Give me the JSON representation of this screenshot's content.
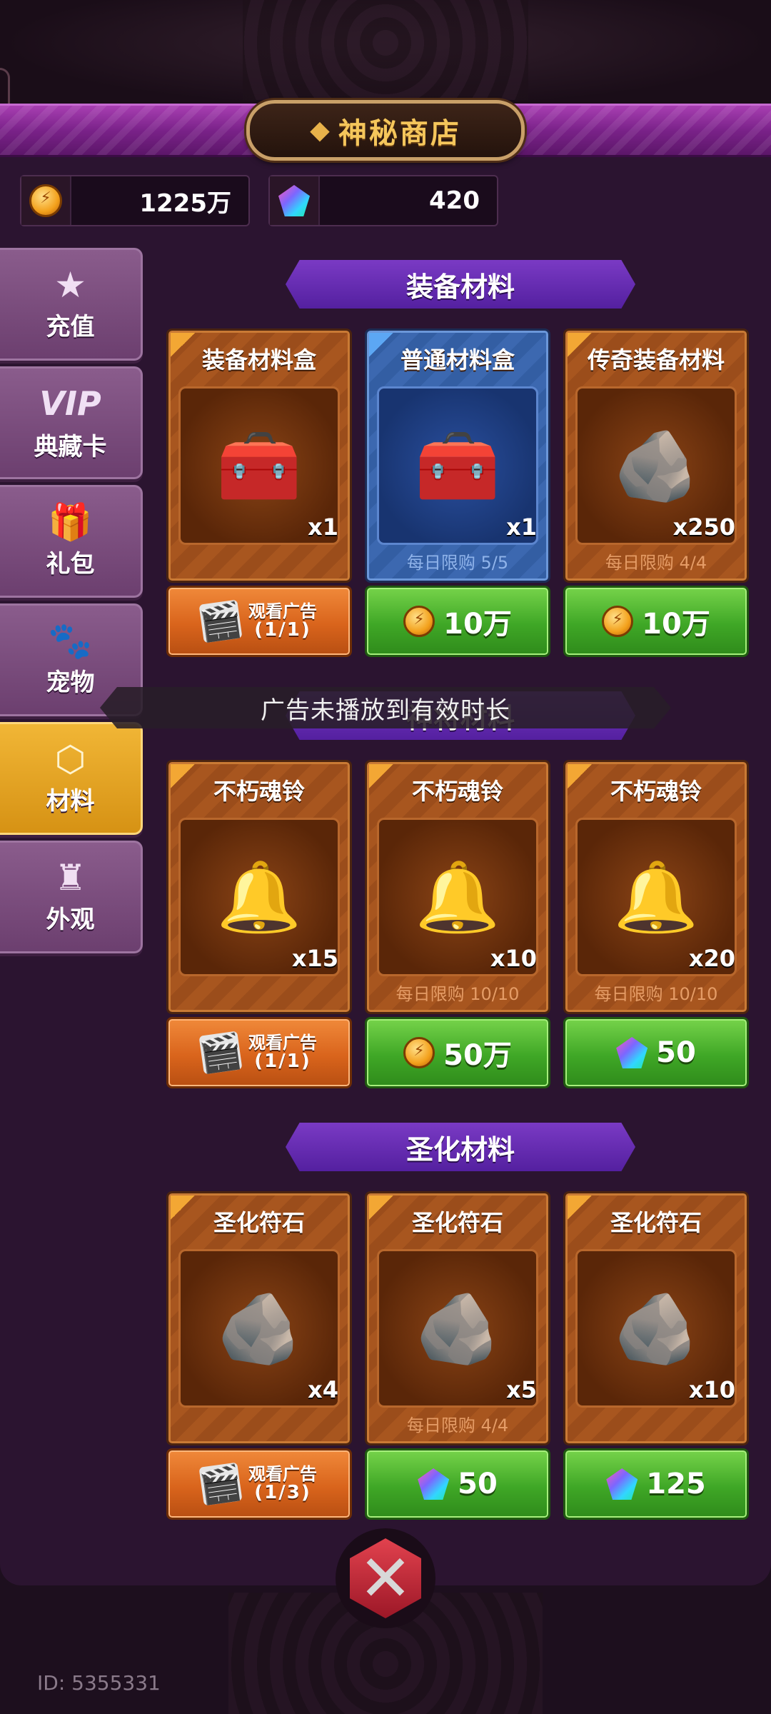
{
  "header": {
    "title": "神秘商店"
  },
  "currency": {
    "gold": "1225万",
    "diamonds": "420"
  },
  "sidebar": {
    "items": [
      {
        "label": "充值",
        "icon": "star-icon"
      },
      {
        "label": "典藏卡",
        "badge": "VIP",
        "icon": "vip-icon"
      },
      {
        "label": "礼包",
        "icon": "gift-icon"
      },
      {
        "label": "宠物",
        "icon": "pet-icon"
      },
      {
        "label": "材料",
        "icon": "hexagon-icon",
        "active": true
      },
      {
        "label": "外观",
        "icon": "armor-icon"
      }
    ]
  },
  "sections": [
    {
      "title": "装备材料",
      "items": [
        {
          "name": "装备材料盒",
          "qty": "x1",
          "limit": "",
          "price": "观看广告",
          "ad_count": "(1/1)",
          "currency": "ad",
          "style": "orange"
        },
        {
          "name": "普通材料盒",
          "qty": "x1",
          "limit": "每日限购 5/5",
          "price": "10万",
          "currency": "gold",
          "style": "blue"
        },
        {
          "name": "传奇装备材料",
          "qty": "x250",
          "limit": "每日限购 4/4",
          "price": "10万",
          "currency": "gold",
          "style": "orange"
        }
      ]
    },
    {
      "title": "神将材料",
      "items": [
        {
          "name": "不朽魂铃",
          "qty": "x15",
          "limit": "",
          "price": "观看广告",
          "ad_count": "(1/1)",
          "currency": "ad"
        },
        {
          "name": "不朽魂铃",
          "qty": "x10",
          "limit": "每日限购 10/10",
          "price": "50万",
          "currency": "gold"
        },
        {
          "name": "不朽魂铃",
          "qty": "x20",
          "limit": "每日限购 10/10",
          "price": "50",
          "currency": "diamond"
        }
      ]
    },
    {
      "title": "圣化材料",
      "items": [
        {
          "name": "圣化符石",
          "qty": "x4",
          "limit": "",
          "price": "观看广告",
          "ad_count": "(1/3)",
          "currency": "ad"
        },
        {
          "name": "圣化符石",
          "qty": "x5",
          "limit": "每日限购 4/4",
          "price": "50",
          "currency": "diamond"
        },
        {
          "name": "圣化符石",
          "qty": "x10",
          "limit": "",
          "price": "125",
          "currency": "diamond"
        }
      ]
    }
  ],
  "toast": "广告未播放到有效时长",
  "footer": {
    "id_text": "ID: 5355331"
  },
  "colors": {
    "accent_gold": "#f5c65b",
    "tab_active": "#f1b636",
    "buy_green": "#3fa726",
    "ad_orange": "#d9641c"
  }
}
